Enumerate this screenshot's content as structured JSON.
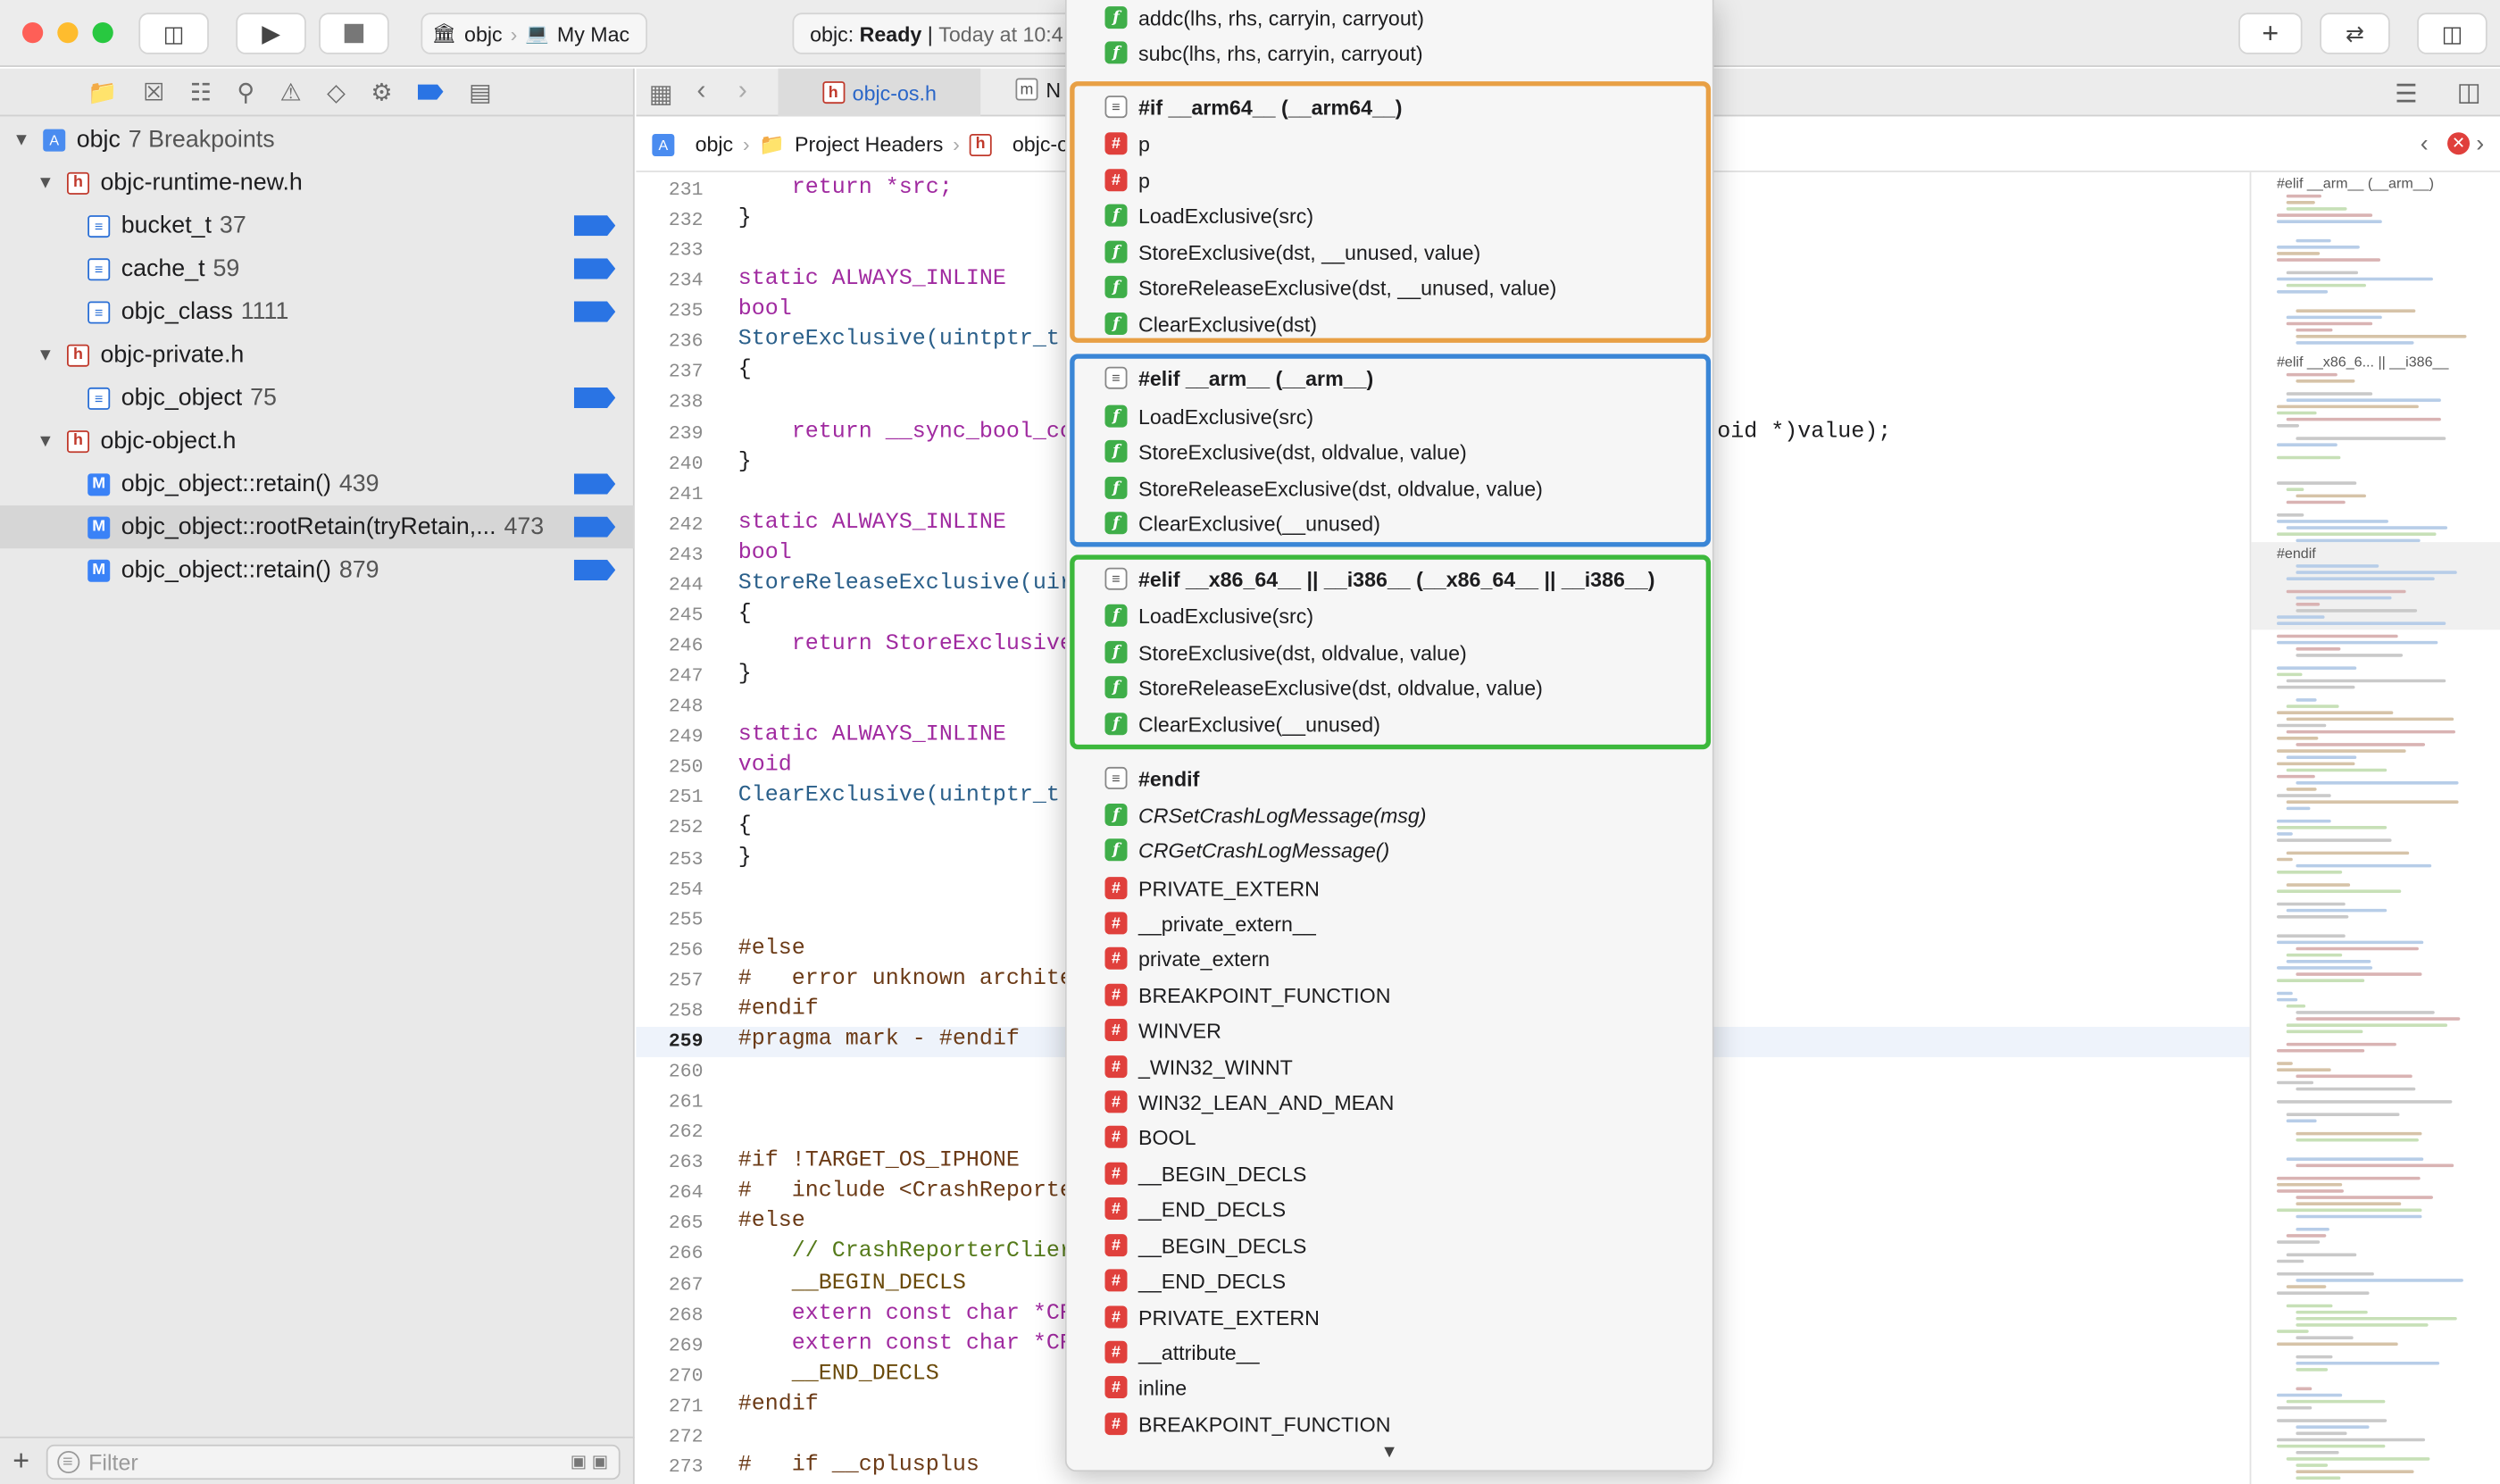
{
  "toolbar": {
    "scheme_target": "objc",
    "scheme_device": "My Mac",
    "status_prefix": "objc: ",
    "status_state": "Ready",
    "status_sep": " | ",
    "status_time": "Today at 10:4"
  },
  "navigator": {
    "project": "objc",
    "breakpoint_count": "7 Breakpoints",
    "rows": [
      {
        "kind": "file",
        "label": "objc-runtime-new.h"
      },
      {
        "kind": "bp",
        "label": "bucket_t",
        "count": "37"
      },
      {
        "kind": "bp",
        "label": "cache_t",
        "count": "59"
      },
      {
        "kind": "bp",
        "label": "objc_class",
        "count": "1111"
      },
      {
        "kind": "file",
        "label": "objc-private.h"
      },
      {
        "kind": "bp",
        "label": "objc_object",
        "count": "75"
      },
      {
        "kind": "file",
        "label": "objc-object.h"
      },
      {
        "kind": "m",
        "label": "objc_object::retain()",
        "count": "439"
      },
      {
        "kind": "m",
        "label": "objc_object::rootRetain(tryRetain,...",
        "count": "473"
      },
      {
        "kind": "m",
        "label": "objc_object::retain()",
        "count": "879"
      }
    ],
    "filter_placeholder": "Filter"
  },
  "editor": {
    "tab_active": "objc-os.h",
    "tab_other": "N",
    "crumbs": [
      "objc",
      "Project Headers",
      "objc-os."
    ],
    "lines": [
      {
        "n": "231",
        "t": "    return *src;"
      },
      {
        "n": "232",
        "t": "}"
      },
      {
        "n": "233",
        "t": ""
      },
      {
        "n": "234",
        "t": "static ALWAYS_INLINE"
      },
      {
        "n": "235",
        "t": "bool"
      },
      {
        "n": "236",
        "t": "StoreExclusive(uintptr_t"
      },
      {
        "n": "237",
        "t": "{"
      },
      {
        "n": "238",
        "t": ""
      },
      {
        "n": "239",
        "t": "    return __sync_bool_co"
      },
      {
        "n": "240",
        "t": "}"
      },
      {
        "n": "241",
        "t": ""
      },
      {
        "n": "242",
        "t": "static ALWAYS_INLINE"
      },
      {
        "n": "243",
        "t": "bool"
      },
      {
        "n": "244",
        "t": "StoreReleaseExclusive(uir"
      },
      {
        "n": "245",
        "t": "{"
      },
      {
        "n": "246",
        "t": "    return StoreExclusive"
      },
      {
        "n": "247",
        "t": "}"
      },
      {
        "n": "248",
        "t": ""
      },
      {
        "n": "249",
        "t": "static ALWAYS_INLINE"
      },
      {
        "n": "250",
        "t": "void"
      },
      {
        "n": "251",
        "t": "ClearExclusive(uintptr_t"
      },
      {
        "n": "252",
        "t": "{"
      },
      {
        "n": "253",
        "t": "}"
      },
      {
        "n": "254",
        "t": ""
      },
      {
        "n": "255",
        "t": ""
      },
      {
        "n": "256",
        "t": "#else"
      },
      {
        "n": "257",
        "t": "#   error unknown archite"
      },
      {
        "n": "258",
        "t": "#endif"
      },
      {
        "n": "259",
        "t": "#pragma mark - #endif"
      },
      {
        "n": "260",
        "t": ""
      },
      {
        "n": "261",
        "t": ""
      },
      {
        "n": "262",
        "t": ""
      },
      {
        "n": "263",
        "t": "#if !TARGET_OS_IPHONE"
      },
      {
        "n": "264",
        "t": "#   include <CrashReporte"
      },
      {
        "n": "265",
        "t": "#else"
      },
      {
        "n": "266",
        "t": "    // CrashReporterClier"
      },
      {
        "n": "267",
        "t": "    __BEGIN_DECLS"
      },
      {
        "n": "268",
        "t": "    extern const char *CR"
      },
      {
        "n": "269",
        "t": "    extern const char *CR"
      },
      {
        "n": "270",
        "t": "    __END_DECLS"
      },
      {
        "n": "271",
        "t": "#endif"
      },
      {
        "n": "272",
        "t": ""
      },
      {
        "n": "273",
        "t": "#   if __cplusplus"
      }
    ],
    "line_239_tail": "oid *)value);"
  },
  "minimap": {
    "labels": [
      "#elif __arm__ (__arm__)",
      "#elif __x86_6... || __i386__",
      "#endif"
    ]
  },
  "popup": {
    "items": [
      {
        "icon": "f",
        "label": "addc(lhs, rhs, carryin, carryout)"
      },
      {
        "icon": "f",
        "label": "subc(lhs, rhs, carryin, carryout)"
      },
      {
        "icon": "m",
        "label": "#if __arm64__ (__arm64__)",
        "bold": true
      },
      {
        "icon": "h",
        "label": "p"
      },
      {
        "icon": "h",
        "label": "p"
      },
      {
        "icon": "f",
        "label": "LoadExclusive(src)"
      },
      {
        "icon": "f",
        "label": "StoreExclusive(dst, __unused, value)"
      },
      {
        "icon": "f",
        "label": "StoreReleaseExclusive(dst, __unused, value)"
      },
      {
        "icon": "f",
        "label": "ClearExclusive(dst)"
      },
      {
        "icon": "m",
        "label": "#elif __arm__ (__arm__)",
        "bold": true
      },
      {
        "icon": "f",
        "label": "LoadExclusive(src)"
      },
      {
        "icon": "f",
        "label": "StoreExclusive(dst, oldvalue, value)"
      },
      {
        "icon": "f",
        "label": "StoreReleaseExclusive(dst, oldvalue, value)"
      },
      {
        "icon": "f",
        "label": "ClearExclusive(__unused)"
      },
      {
        "icon": "m",
        "label": "#elif __x86_64__ || __i386__ (__x86_64__ || __i386__)",
        "bold": true
      },
      {
        "icon": "f",
        "label": "LoadExclusive(src)"
      },
      {
        "icon": "f",
        "label": "StoreExclusive(dst, oldvalue, value)"
      },
      {
        "icon": "f",
        "label": "StoreReleaseExclusive(dst, oldvalue, value)"
      },
      {
        "icon": "f",
        "label": "ClearExclusive(__unused)"
      },
      {
        "icon": "m",
        "label": "#endif",
        "bold": true
      },
      {
        "icon": "f",
        "label": "CRSetCrashLogMessage(msg)",
        "italic": true
      },
      {
        "icon": "f",
        "label": "CRGetCrashLogMessage()",
        "italic": true
      },
      {
        "icon": "h",
        "label": "PRIVATE_EXTERN"
      },
      {
        "icon": "h",
        "label": "__private_extern__"
      },
      {
        "icon": "h",
        "label": "private_extern"
      },
      {
        "icon": "h",
        "label": "BREAKPOINT_FUNCTION"
      },
      {
        "icon": "h",
        "label": "WINVER"
      },
      {
        "icon": "h",
        "label": "_WIN32_WINNT"
      },
      {
        "icon": "h",
        "label": "WIN32_LEAN_AND_MEAN"
      },
      {
        "icon": "h",
        "label": "BOOL"
      },
      {
        "icon": "h",
        "label": "__BEGIN_DECLS"
      },
      {
        "icon": "h",
        "label": "__END_DECLS"
      },
      {
        "icon": "h",
        "label": "__BEGIN_DECLS"
      },
      {
        "icon": "h",
        "label": "__END_DECLS"
      },
      {
        "icon": "h",
        "label": "PRIVATE_EXTERN"
      },
      {
        "icon": "h",
        "label": "__attribute__"
      },
      {
        "icon": "h",
        "label": "inline"
      },
      {
        "icon": "h",
        "label": "BREAKPOINT_FUNCTION"
      }
    ],
    "group_colors": [
      "#e8a045",
      "#3a86d6",
      "#3cb83c"
    ]
  }
}
